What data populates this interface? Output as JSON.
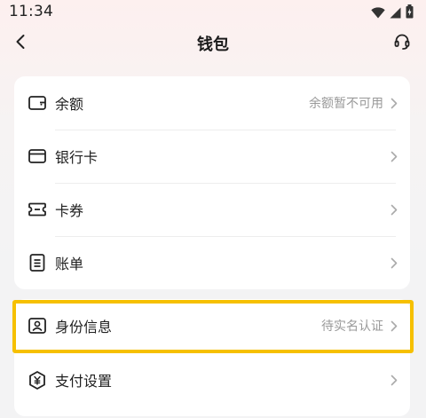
{
  "status_bar": {
    "time": "11:34"
  },
  "header": {
    "title": "钱包"
  },
  "wallet_items": [
    {
      "label": "余额",
      "status": "余额暂不可用"
    },
    {
      "label": "银行卡",
      "status": ""
    },
    {
      "label": "卡券",
      "status": ""
    },
    {
      "label": "账单",
      "status": ""
    }
  ],
  "settings_items": [
    {
      "label": "身份信息",
      "status": "待实名认证"
    },
    {
      "label": "支付设置",
      "status": ""
    }
  ],
  "colors": {
    "highlight": "#f6c000",
    "status_text": "#999999",
    "card_bg": "#ffffff"
  }
}
